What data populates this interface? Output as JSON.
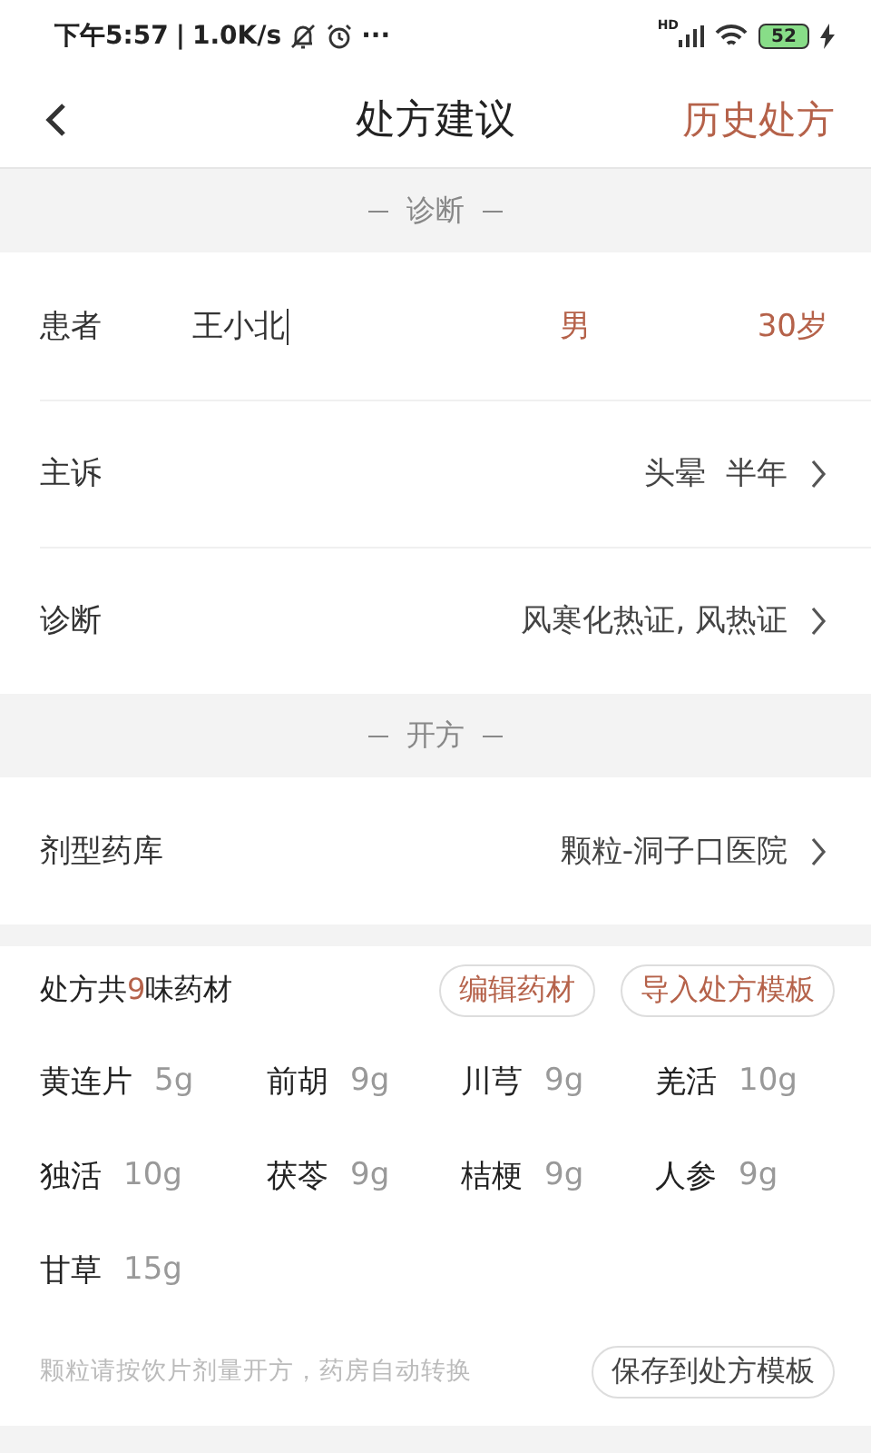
{
  "status_bar": {
    "time": "下午5:57",
    "separator": "|",
    "speed": "1.0K/s",
    "more": "···",
    "network": "HD",
    "battery": "52"
  },
  "nav": {
    "title": "处方建议",
    "action": "历史处方"
  },
  "sections": [
    {
      "title": "诊断",
      "rows": [
        {
          "kind": "patient",
          "label": "患者",
          "name": "王小北",
          "gender": "男",
          "age": "30岁"
        },
        {
          "kind": "link",
          "label": "主诉",
          "value": "头晕  半年"
        },
        {
          "kind": "link",
          "label": "诊断",
          "value": "风寒化热证, 风热证"
        }
      ]
    },
    {
      "title": "开方",
      "rows": [
        {
          "kind": "link",
          "label": "剂型药库",
          "value": "颗粒-洞子口医院"
        }
      ]
    }
  ],
  "prescription": {
    "count_prefix": "处方共",
    "count": "9",
    "count_suffix": "味药材",
    "buttons": [
      "编辑药材",
      "导入处方模板"
    ],
    "herbs": [
      {
        "name": "黄连片",
        "dose": "5g"
      },
      {
        "name": "前胡",
        "dose": "9g"
      },
      {
        "name": "川芎",
        "dose": "9g"
      },
      {
        "name": "羌活",
        "dose": "10g"
      },
      {
        "name": "独活",
        "dose": "10g"
      },
      {
        "name": "茯苓",
        "dose": "9g"
      },
      {
        "name": "桔梗",
        "dose": "9g"
      },
      {
        "name": "人参",
        "dose": "9g"
      },
      {
        "name": "甘草",
        "dose": "15g"
      }
    ],
    "note": "颗粒请按饮片剂量开方，药房自动转换",
    "save_button": "保存到处方模板"
  }
}
